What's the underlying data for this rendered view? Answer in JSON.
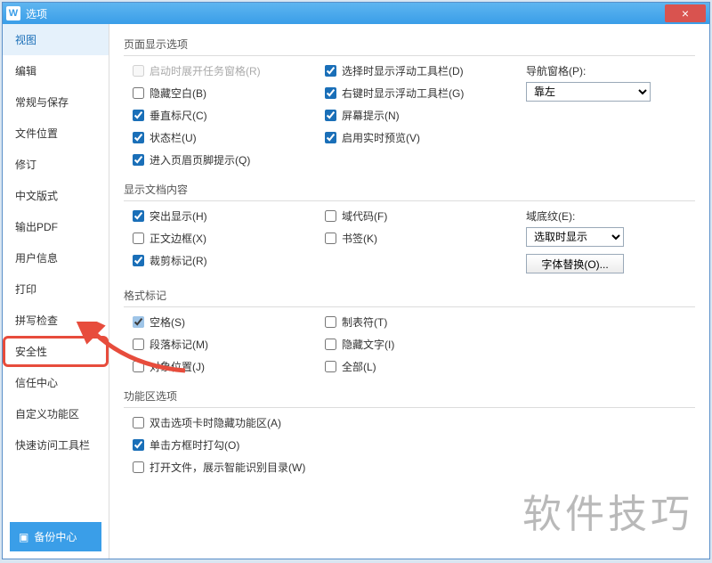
{
  "window": {
    "title": "选项",
    "close_icon": "×",
    "app_icon": "W"
  },
  "sidebar": {
    "items": [
      {
        "label": "视图",
        "selected": true
      },
      {
        "label": "编辑"
      },
      {
        "label": "常规与保存"
      },
      {
        "label": "文件位置"
      },
      {
        "label": "修订"
      },
      {
        "label": "中文版式"
      },
      {
        "label": "输出PDF"
      },
      {
        "label": "用户信息"
      },
      {
        "label": "打印"
      },
      {
        "label": "拼写检查"
      },
      {
        "label": "安全性",
        "highlight": true
      },
      {
        "label": "信任中心"
      },
      {
        "label": "自定义功能区"
      },
      {
        "label": "快速访问工具栏"
      }
    ],
    "backup_label": "备份中心"
  },
  "sections": {
    "page_display": {
      "title": "页面显示选项",
      "col1": [
        {
          "label": "启动时展开任务窗格(R)",
          "checked": false,
          "disabled": true
        },
        {
          "label": "隐藏空白(B)",
          "checked": false
        },
        {
          "label": "垂直标尺(C)",
          "checked": true
        },
        {
          "label": "状态栏(U)",
          "checked": true
        },
        {
          "label": "进入页眉页脚提示(Q)",
          "checked": true
        }
      ],
      "col2": [
        {
          "label": "选择时显示浮动工具栏(D)",
          "checked": true
        },
        {
          "label": "右键时显示浮动工具栏(G)",
          "checked": true
        },
        {
          "label": "屏幕提示(N)",
          "checked": true
        },
        {
          "label": "启用实时预览(V)",
          "checked": true
        }
      ],
      "nav_pane": {
        "label": "导航窗格(P):",
        "value": "靠左"
      }
    },
    "doc_content": {
      "title": "显示文档内容",
      "col1": [
        {
          "label": "突出显示(H)",
          "checked": true
        },
        {
          "label": "正文边框(X)",
          "checked": false
        },
        {
          "label": "裁剪标记(R)",
          "checked": true
        }
      ],
      "col2": [
        {
          "label": "域代码(F)",
          "checked": false
        },
        {
          "label": "书签(K)",
          "checked": false
        }
      ],
      "shading": {
        "label": "域底纹(E):",
        "value": "选取时显示"
      },
      "font_sub_btn": "字体替换(O)..."
    },
    "format_marks": {
      "title": "格式标记",
      "col1": [
        {
          "label": "空格(S)",
          "checked": true,
          "light": true
        },
        {
          "label": "段落标记(M)",
          "checked": false
        },
        {
          "label": "对象位置(J)",
          "checked": false
        }
      ],
      "col2": [
        {
          "label": "制表符(T)",
          "checked": false
        },
        {
          "label": "隐藏文字(I)",
          "checked": false
        },
        {
          "label": "全部(L)",
          "checked": false
        }
      ]
    },
    "ribbon": {
      "title": "功能区选项",
      "items": [
        {
          "label": "双击选项卡时隐藏功能区(A)",
          "checked": false
        },
        {
          "label": "单击方框时打勾(O)",
          "checked": true
        },
        {
          "label": "打开文件，展示智能识别目录(W)",
          "checked": false
        }
      ]
    }
  },
  "watermark": "软件技巧"
}
